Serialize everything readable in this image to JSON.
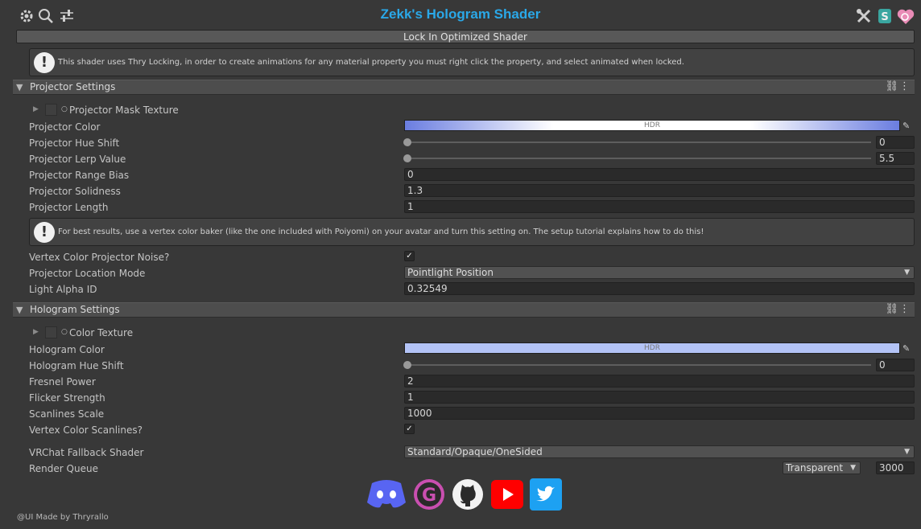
{
  "title": "Zekk's Hologram Shader",
  "lock_button": "Lock In Optimized Shader",
  "info_locking": "This shader uses Thry Locking, in order to create animations for any material property you must right click the property, and select animated when locked.",
  "projector": {
    "header": "Projector Settings",
    "mask_texture": "Projector Mask Texture",
    "color_label": "Projector Color",
    "color_hdr": "HDR",
    "hue_shift_label": "Projector Hue Shift",
    "hue_shift_value": "0",
    "lerp_label": "Projector Lerp Value",
    "lerp_value": "5.5",
    "range_bias_label": "Projector Range Bias",
    "range_bias_value": "0",
    "solidness_label": "Projector Solidness",
    "solidness_value": "1.3",
    "length_label": "Projector Length",
    "length_value": "1",
    "info_vertex": "For best results, use a vertex color baker (like the one included with Poiyomi) on your avatar and turn this setting on. The setup tutorial explains how to do this!",
    "vertex_noise_label": "Vertex Color Projector Noise?",
    "vertex_noise_checked": true,
    "location_mode_label": "Projector Location Mode",
    "location_mode_value": "Pointlight Position",
    "light_alpha_label": "Light Alpha ID",
    "light_alpha_value": "0.32549"
  },
  "hologram": {
    "header": "Hologram Settings",
    "color_texture": "Color Texture",
    "color_label": "Hologram Color",
    "color_hdr": "HDR",
    "hue_shift_label": "Hologram Hue Shift",
    "hue_shift_value": "0",
    "fresnel_label": "Fresnel Power",
    "fresnel_value": "2",
    "flicker_label": "Flicker Strength",
    "flicker_value": "1",
    "scanlines_label": "Scanlines Scale",
    "scanlines_value": "1000",
    "vertex_scan_label": "Vertex Color Scanlines?",
    "vertex_scan_checked": true
  },
  "fallback_label": "VRChat Fallback Shader",
  "fallback_value": "Standard/Opaque/OneSided",
  "render_queue_label": "Render Queue",
  "render_queue_mode": "Transparent",
  "render_queue_value": "3000",
  "footer": "@UI Made by Thryrallo",
  "colors": {
    "title": "#2aa8e8",
    "projector_color": "#6a7de0",
    "hologram_color": "#b3c3f6",
    "discord": "#5865f2",
    "gumroad": "#c94fb0",
    "youtube": "#ff0000",
    "twitter": "#1da1f2"
  },
  "icons": {
    "top_left": [
      "gear-icon",
      "search-icon",
      "sliders-icon"
    ],
    "top_right": [
      "tools-icon",
      "shader-s-icon",
      "heart-icon"
    ],
    "social": [
      "discord-icon",
      "gumroad-icon",
      "github-icon",
      "youtube-icon",
      "twitter-icon"
    ]
  }
}
